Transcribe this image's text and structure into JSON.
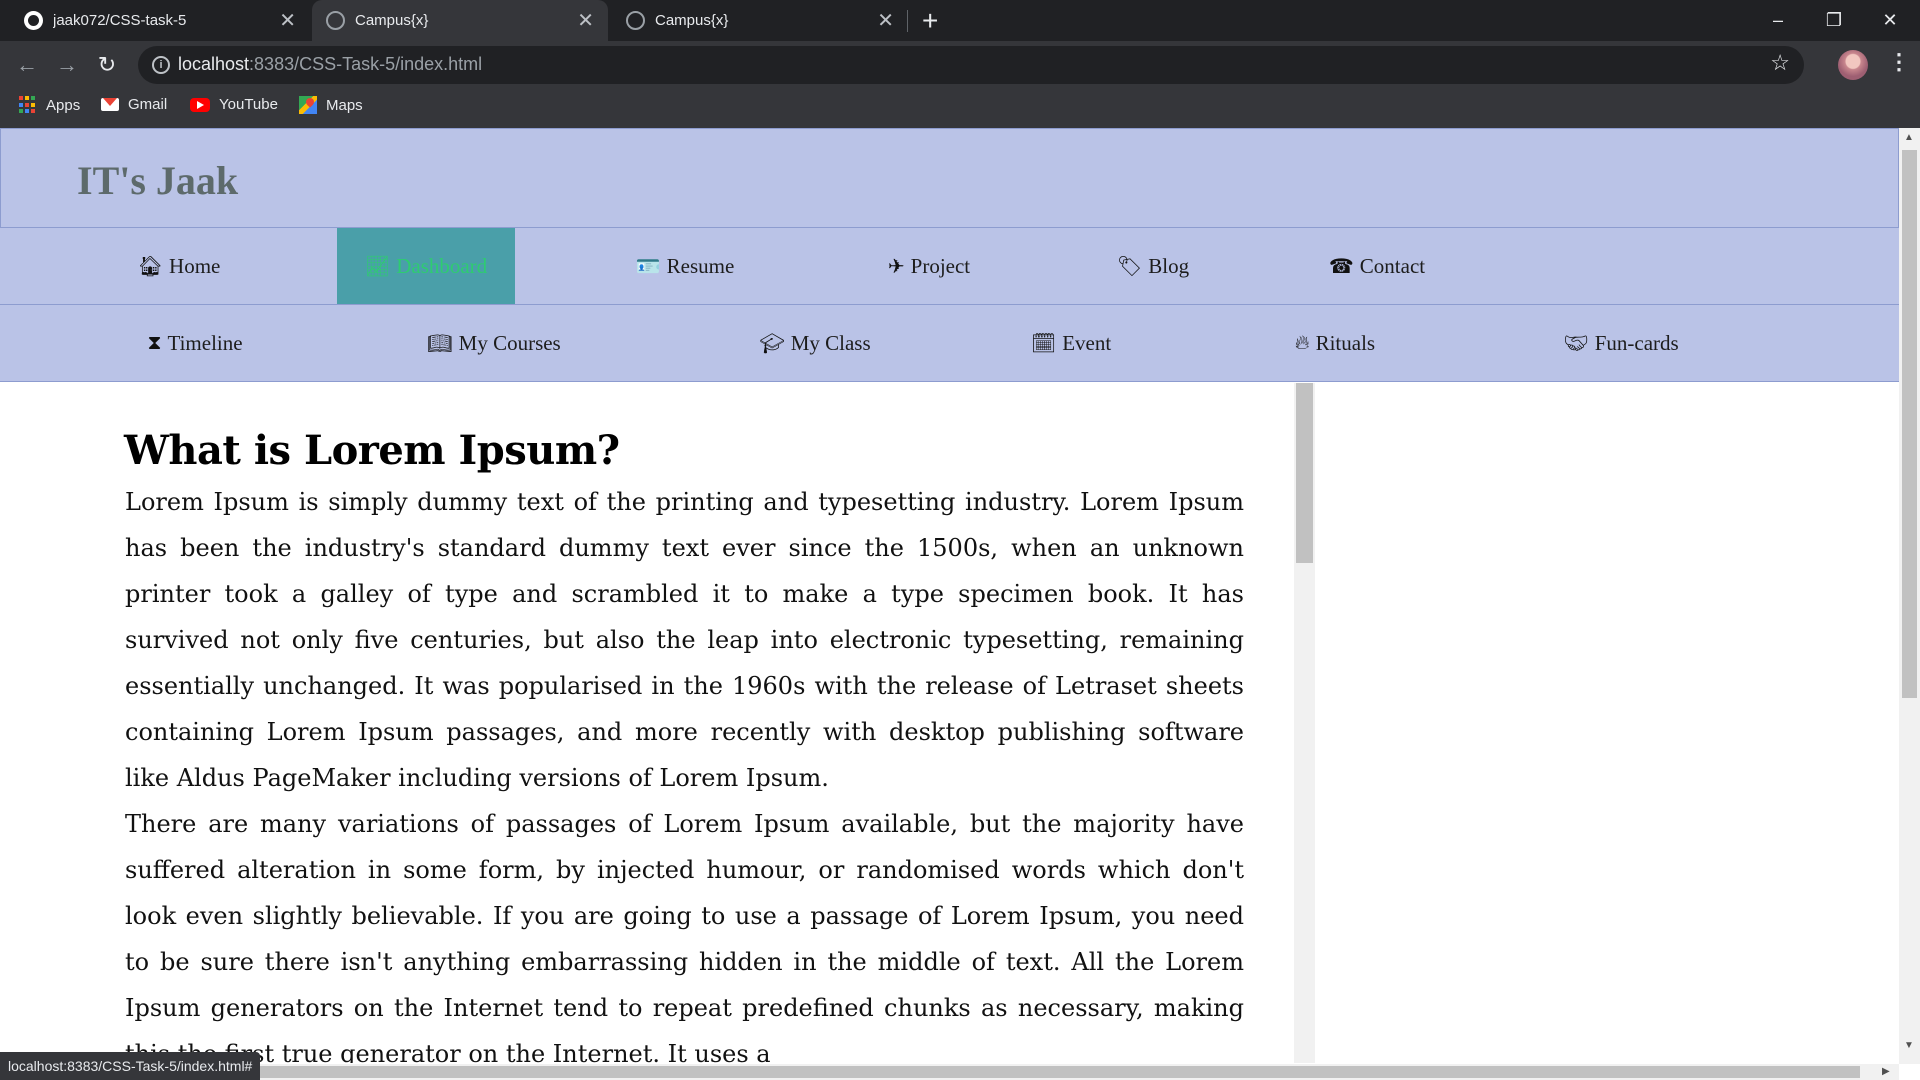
{
  "browser": {
    "tabs": [
      {
        "title": "jaak072/CSS-task-5",
        "icon": "github-icon"
      },
      {
        "title": "Campus{x}",
        "icon": "globe-icon"
      },
      {
        "title": "Campus{x}",
        "icon": "globe-icon"
      }
    ],
    "new_tab_label": "+",
    "window_controls": {
      "minimize": "–",
      "restore": "❐",
      "close": "✕"
    },
    "nav": {
      "back": "←",
      "forward": "→",
      "reload": "↻"
    },
    "url_host": "localhost",
    "url_path": ":8383/CSS-Task-5/index.html",
    "bookmarks": [
      "Apps",
      "Gmail",
      "YouTube",
      "Maps"
    ],
    "status_text": "localhost:8383/CSS-Task-5/index.html#"
  },
  "site": {
    "brand": "IT's Jaak",
    "nav_primary": [
      {
        "label": "Home",
        "icon": "home-icon",
        "glyph": "🏠︎"
      },
      {
        "label": "Dashboard",
        "icon": "line-chart-icon",
        "glyph": "📈︎"
      },
      {
        "label": "Resume",
        "icon": "id-card-icon",
        "glyph": "🪪"
      },
      {
        "label": "Project",
        "icon": "plane-icon",
        "glyph": "✈"
      },
      {
        "label": "Blog",
        "icon": "tag-icon",
        "glyph": "🏷︎"
      },
      {
        "label": "Contact",
        "icon": "phone-volume-icon",
        "glyph": "☎"
      }
    ],
    "nav_secondary": [
      {
        "label": "Timeline",
        "icon": "hourglass-icon",
        "glyph": "⧗"
      },
      {
        "label": "My Courses",
        "icon": "book-icon",
        "glyph": "📖︎"
      },
      {
        "label": "My Class",
        "icon": "graduation-cap-icon",
        "glyph": "🎓︎"
      },
      {
        "label": "Event",
        "icon": "calendar-icon",
        "glyph": "🗓︎"
      },
      {
        "label": "Rituals",
        "icon": "fire-icon",
        "glyph": "🔥︎"
      },
      {
        "label": "Fun-cards",
        "icon": "handshake-icon",
        "glyph": "🤝︎"
      }
    ],
    "active_nav": "Dashboard",
    "accent_color": "#4a9fa9",
    "header_color": "#bac3e7"
  },
  "article": {
    "heading": "What is Lorem Ipsum?",
    "paragraphs": [
      "Lorem Ipsum is simply dummy text of the printing and typesetting industry. Lorem Ipsum has been the industry's standard dummy text ever since the 1500s, when an unknown printer took a galley of type and scrambled it to make a type specimen book. It has survived not only five centuries, but also the leap into electronic typesetting, remaining essentially unchanged. It was popularised in the 1960s with the release of Letraset sheets containing Lorem Ipsum passages, and more recently with desktop publishing software like Aldus PageMaker including versions of Lorem Ipsum.",
      "There are many variations of passages of Lorem Ipsum available, but the majority have suffered alteration in some form, by injected humour, or randomised words which don't look even slightly believable. If you are going to use a passage of Lorem Ipsum, you need to be sure there isn't anything embarrassing hidden in the middle of text. All the Lorem Ipsum generators on the Internet tend to repeat predefined chunks as necessary, making this the first true generator on the Internet. It uses a"
    ]
  }
}
